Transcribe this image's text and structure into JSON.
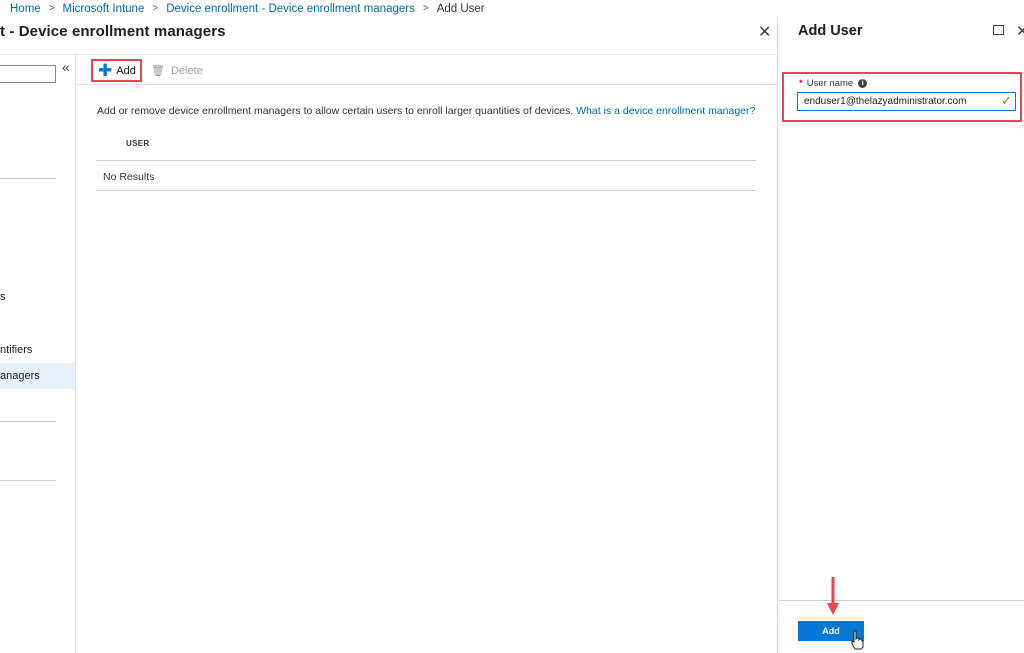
{
  "breadcrumb": {
    "items": [
      "Home",
      "Microsoft Intune",
      "Device enrollment - Device enrollment managers"
    ],
    "current": "Add User",
    "separator": ">"
  },
  "main_blade": {
    "title": "t - Device enrollment managers",
    "close_icon": "close-icon"
  },
  "left_menu": {
    "collapse_icon": "«",
    "items": [
      "s",
      "ntifiers",
      "anagers"
    ],
    "selected_index": 2
  },
  "toolbar": {
    "add_label": "Add",
    "delete_label": "Delete"
  },
  "content": {
    "description": "Add or remove device enrollment managers to allow certain users to enroll larger quantities of devices.",
    "help_link": "What is a device enrollment manager?",
    "column_header": "USER",
    "empty_message": "No Results"
  },
  "right_panel": {
    "title": "Add User",
    "field_label": "User name",
    "required_mark": "*",
    "field_value": "enduser1@thelazyadministrator.com",
    "add_button": "Add"
  },
  "colors": {
    "accent": "#0078d4",
    "link": "#0069b4",
    "highlight_border": "#e8464d",
    "valid_check": "#57a300",
    "selected_bg": "#e6f1fb"
  }
}
